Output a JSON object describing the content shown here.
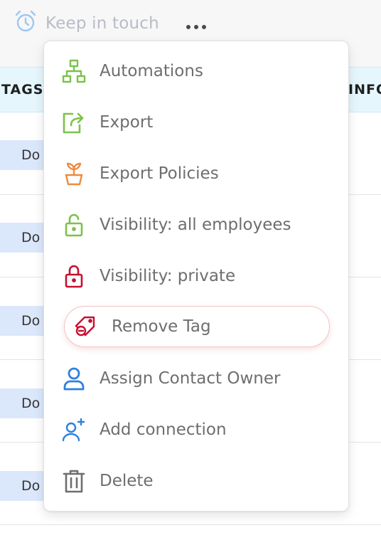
{
  "header": {
    "reminder_label": "Keep in touch"
  },
  "table": {
    "col_tags": "TAGS",
    "col_info": "INFO",
    "rows": [
      {
        "tag": "Do"
      },
      {
        "tag": "Do"
      },
      {
        "tag": "Do"
      },
      {
        "tag": "Do"
      },
      {
        "tag": "Do"
      }
    ]
  },
  "menu": {
    "items": [
      {
        "label": "Automations",
        "icon": "sitemap-icon",
        "color": "#7cc24a"
      },
      {
        "label": "Export",
        "icon": "export-icon",
        "color": "#7cc24a"
      },
      {
        "label": "Export Policies",
        "icon": "plant-pot-icon",
        "color": "#f08a3c"
      },
      {
        "label": "Visibility: all employees",
        "icon": "unlock-icon",
        "color": "#7cc24a"
      },
      {
        "label": "Visibility: private",
        "icon": "lock-icon",
        "color": "#c8102e"
      },
      {
        "label": "Remove Tag",
        "icon": "tag-remove-icon",
        "color": "#c8102e"
      },
      {
        "label": "Assign Contact Owner",
        "icon": "user-icon",
        "color": "#2f7fe0"
      },
      {
        "label": "Add connection",
        "icon": "user-plus-icon",
        "color": "#2f7fe0"
      },
      {
        "label": "Delete",
        "icon": "trash-icon",
        "color": "#6e6e6e"
      }
    ]
  }
}
